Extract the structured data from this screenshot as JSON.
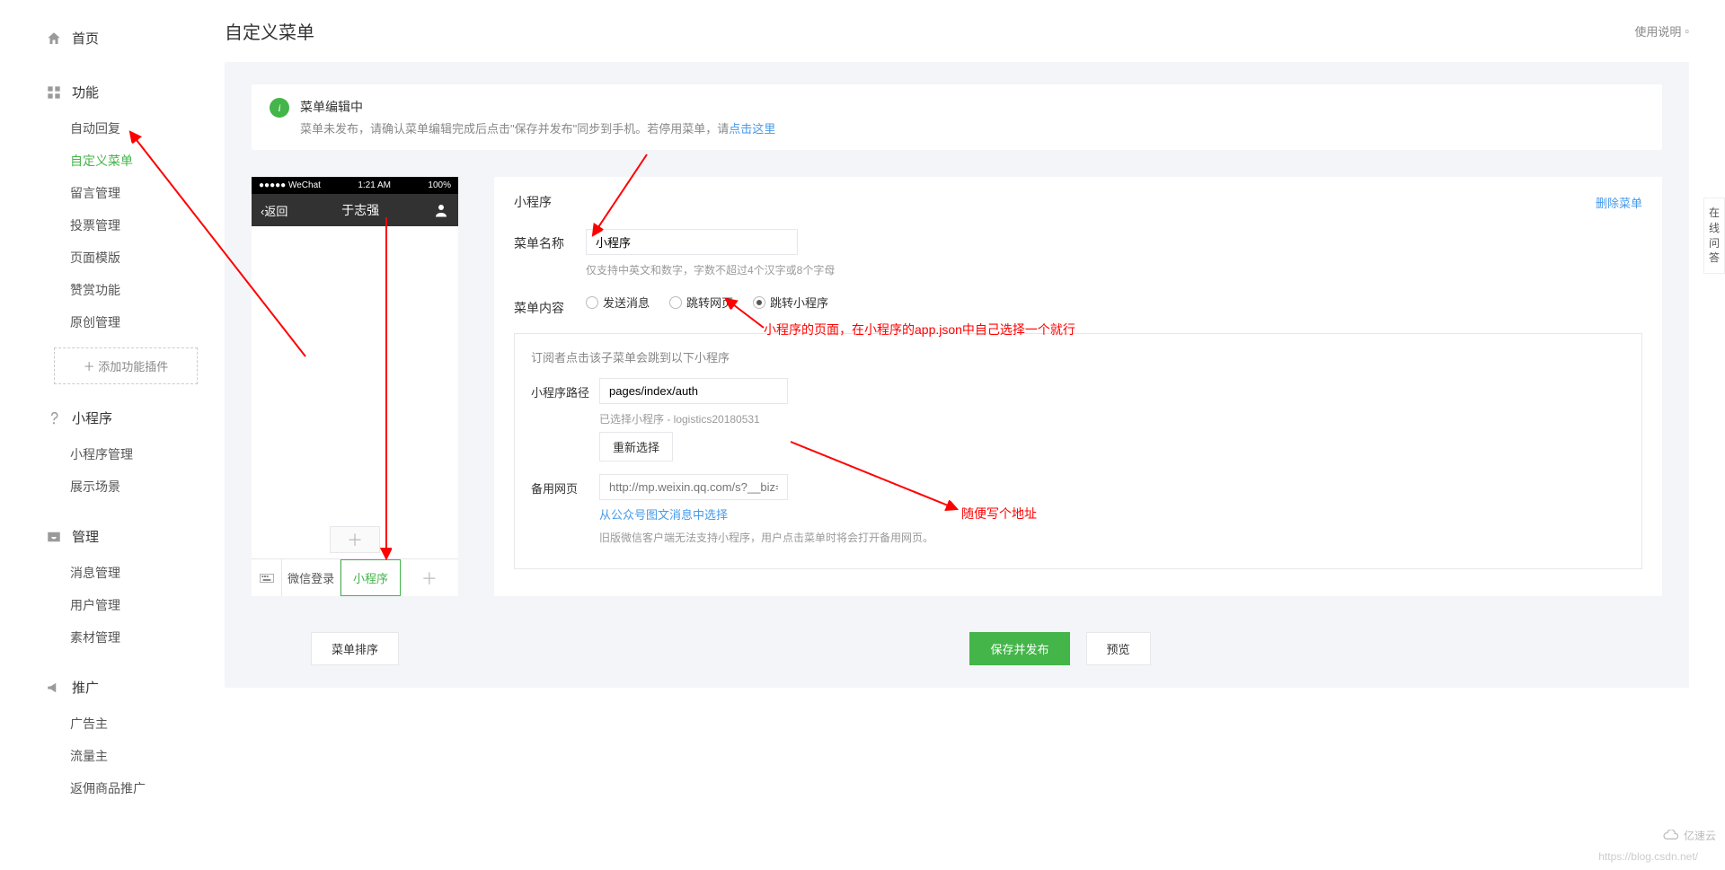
{
  "sidebar": {
    "home": "首页",
    "func": "功能",
    "func_items": [
      "自动回复",
      "自定义菜单",
      "留言管理",
      "投票管理",
      "页面模版",
      "赞赏功能",
      "原创管理"
    ],
    "add_plugin": "添加功能插件",
    "mini": "小程序",
    "mini_items": [
      "小程序管理",
      "展示场景"
    ],
    "mgmt": "管理",
    "mgmt_items": [
      "消息管理",
      "用户管理",
      "素材管理"
    ],
    "promo": "推广",
    "promo_items": [
      "广告主",
      "流量主",
      "返佣商品推广"
    ]
  },
  "page": {
    "title": "自定义菜单",
    "help": "使用说明"
  },
  "notice": {
    "title": "菜单编辑中",
    "desc_a": "菜单未发布，请确认菜单编辑完成后点击\"保存并发布\"同步到手机。若停用菜单，请",
    "link": "点击这里"
  },
  "phone": {
    "carrier": "●●●●● WeChat",
    "time": "1:21 AM",
    "battery": "100%",
    "back": "返回",
    "nav_title": "于志强",
    "menu1": "微信登录",
    "menu2": "小程序"
  },
  "config": {
    "section_title": "小程序",
    "delete": "删除菜单",
    "name_label": "菜单名称",
    "name_value": "小程序",
    "name_hint": "仅支持中英文和数字，字数不超过4个汉字或8个字母",
    "content_label": "菜单内容",
    "radio_msg": "发送消息",
    "radio_web": "跳转网页",
    "radio_mp": "跳转小程序",
    "sub_hint": "订阅者点击该子菜单会跳到以下小程序",
    "path_label": "小程序路径",
    "path_value": "pages/index/auth",
    "selected_hint": "已选择小程序 - logistics20180531",
    "reselect": "重新选择",
    "backup_label": "备用网页",
    "backup_placeholder": "http://mp.weixin.qq.com/s?__biz=MzA",
    "backup_link": "从公众号图文消息中选择",
    "backup_hint": "旧版微信客户端无法支持小程序，用户点击菜单时将会打开备用网页。"
  },
  "actions": {
    "sort": "菜单排序",
    "save": "保存并发布",
    "preview": "预览"
  },
  "annot": {
    "a1": "小程序的页面，在小程序的app.json中自己选择一个就行",
    "a2": "随便写个地址"
  },
  "side_tab": "在线问答",
  "watermark": "https://blog.csdn.net/",
  "cloud": "亿速云"
}
